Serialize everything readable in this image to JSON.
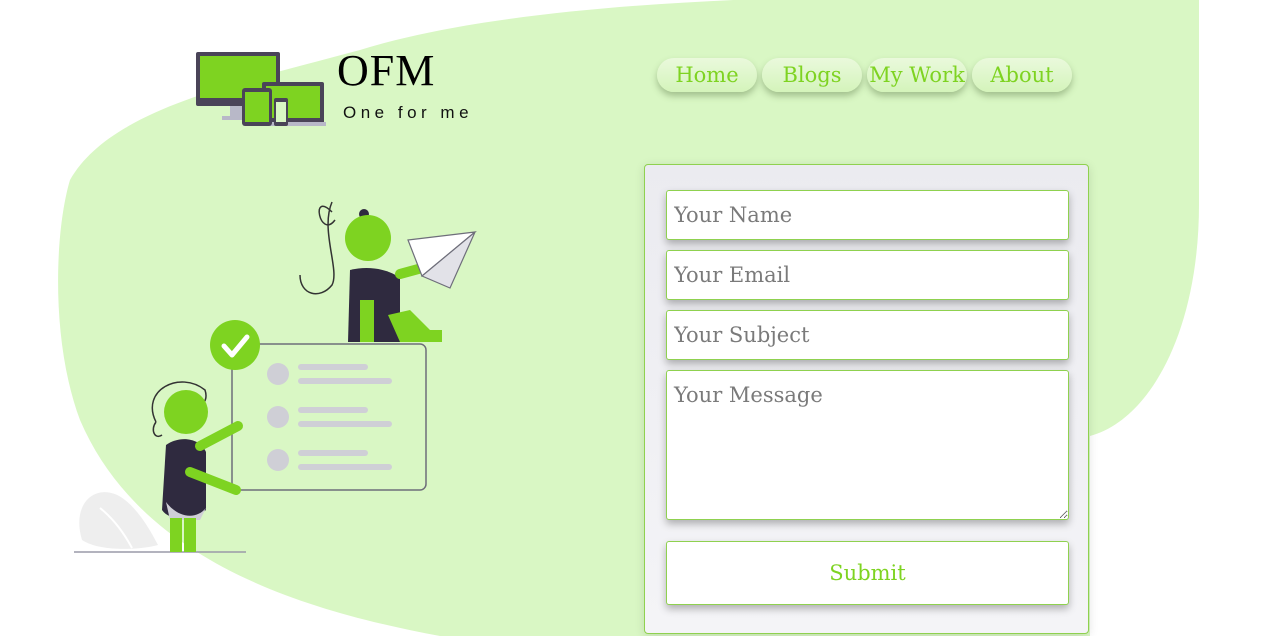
{
  "brand": {
    "name": "OFM",
    "tagline": "One for me"
  },
  "nav": {
    "items": [
      {
        "label": "Home"
      },
      {
        "label": "Blogs"
      },
      {
        "label": "My Work"
      },
      {
        "label": "About"
      }
    ]
  },
  "contact_form": {
    "name_placeholder": "Your Name",
    "email_placeholder": "Your Email",
    "subject_placeholder": "Your Subject",
    "message_placeholder": "Your Message",
    "submit_label": "Submit"
  },
  "colors": {
    "accent_green": "#7ed321",
    "background_blob": "#d9f7c4",
    "dark_figure": "#2f2a3f"
  },
  "icons": {
    "logo": "devices-logo-icon",
    "illustration": "people-checklist-paper-plane-illustration",
    "check": "checkmark-icon"
  }
}
